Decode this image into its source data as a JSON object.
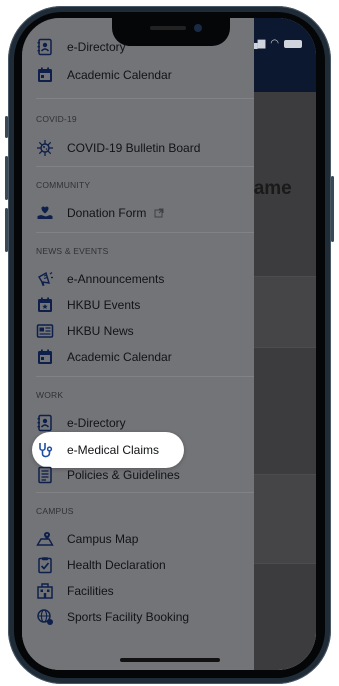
{
  "colors": {
    "header": "#0c1830",
    "drawer": "#737478",
    "icon_accent": "#0d1f4a",
    "highlight": "#ffffff"
  },
  "page_title_partial": "Name",
  "sections": {
    "covid": "COVID-19",
    "community": "COMMUNITY",
    "news": "NEWS & EVENTS",
    "work": "WORK",
    "campus": "CAMPUS"
  },
  "items": {
    "e_directory_top": "e-Directory",
    "academic_calendar_top": "Academic Calendar",
    "covid_board": "COVID-19 Bulletin Board",
    "donation_form": "Donation Form",
    "e_announcements": "e-Announcements",
    "hkbu_events": "HKBU Events",
    "hkbu_news": "HKBU News",
    "academic_calendar": "Academic Calendar",
    "e_directory": "e-Directory",
    "e_medical_claims": "e-Medical Claims",
    "policies": "Policies & Guidelines",
    "campus_map": "Campus Map",
    "health_declaration": "Health Declaration",
    "facilities": "Facilities",
    "sports_booking": "Sports Facility Booking"
  },
  "icons": {
    "e_directory": "directory-icon",
    "academic_calendar": "calendar-icon",
    "covid_board": "virus-icon",
    "donation_form": "heart-hand-icon",
    "external_link": "external-link-icon",
    "e_announcements": "megaphone-icon",
    "hkbu_events": "event-calendar-icon",
    "hkbu_news": "newspaper-icon",
    "e_medical_claims": "stethoscope-icon",
    "policies": "document-icon",
    "campus_map": "map-icon",
    "health_declaration": "clipboard-check-icon",
    "facilities": "building-icon",
    "sports_booking": "sports-globe-icon"
  }
}
